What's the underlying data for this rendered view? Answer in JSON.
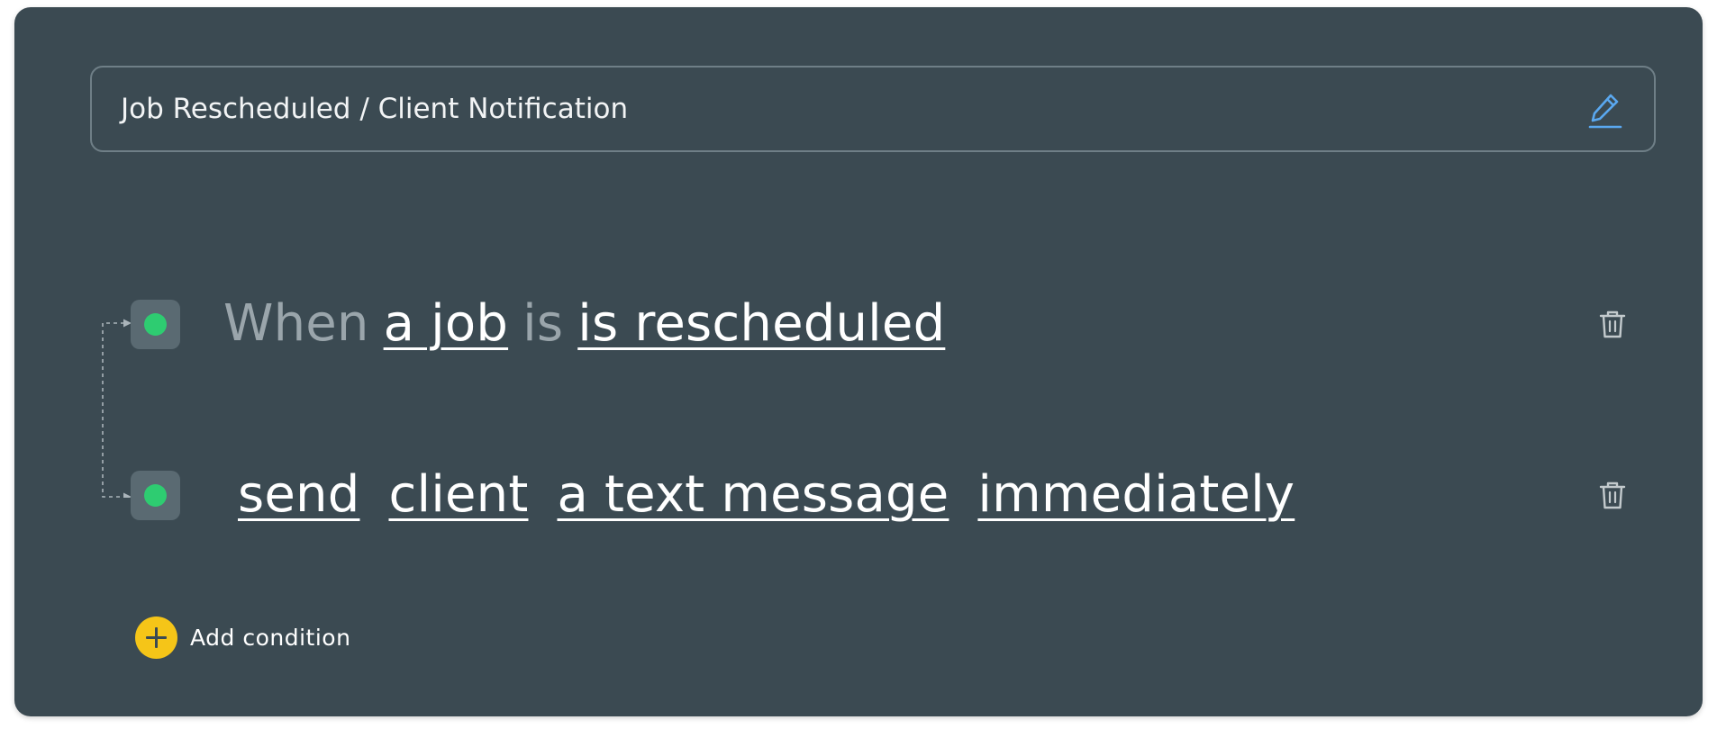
{
  "header": {
    "title": "Job Rescheduled / Client Notification",
    "edit_icon": "pencil-icon",
    "edit_color": "#5aa8f0"
  },
  "trigger": {
    "prefix": "When",
    "subject": "a job",
    "connector": "is",
    "event": "is rescheduled",
    "status_color": "#2ecc71",
    "delete_icon": "trash-icon"
  },
  "action": {
    "verb": "send",
    "recipient": "client",
    "channel": "a text message",
    "timing": "immediately",
    "status_color": "#2ecc71",
    "delete_icon": "trash-icon"
  },
  "footer": {
    "add_condition_label": "Add condition",
    "add_icon": "plus-icon",
    "accent": "#f5c518"
  },
  "colors": {
    "card_background": "#3b4a52"
  }
}
